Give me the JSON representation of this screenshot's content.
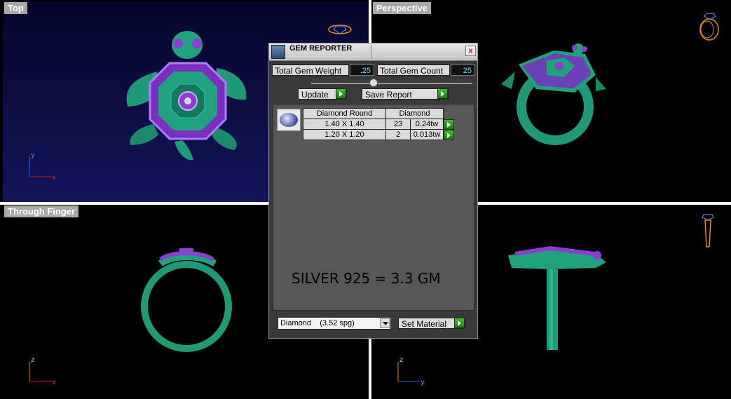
{
  "viewports": {
    "top": {
      "label": "Top",
      "axis_h": "x",
      "axis_v": "y"
    },
    "perspective": {
      "label": "Perspective"
    },
    "through_finger": {
      "label": "Through Finger",
      "axis_h": "x",
      "axis_v": "z"
    },
    "bottom_right": {
      "axis_h": "y",
      "axis_v": "z"
    }
  },
  "dialog": {
    "title": "GEM REPORTER",
    "close": "x",
    "total_gem_weight_label": "Total Gem Weight",
    "total_gem_weight_value": ".25",
    "total_gem_count_label": "Total Gem Count",
    "total_gem_count_value": "25",
    "update_label": "Update",
    "save_report_label": "Save Report",
    "table": {
      "headers": [
        "Diamond Round",
        "Diamond"
      ],
      "rows": [
        {
          "size": "1.40 X 1.40",
          "count": "23",
          "weight": "0.24tw"
        },
        {
          "size": "1.20 X 1.20",
          "count": "2",
          "weight": "0.013tw"
        }
      ]
    },
    "note": "SILVER 925 = 3.3 GM",
    "material_select_value": "Diamond    (3.52 spg)",
    "set_material_label": "Set Material"
  },
  "colors": {
    "ring_green": "#1f9b77",
    "gem_purple": "#8a3fd0",
    "top_bg": "#0a0a3c",
    "accent_cyan": "#6bd6ff"
  }
}
